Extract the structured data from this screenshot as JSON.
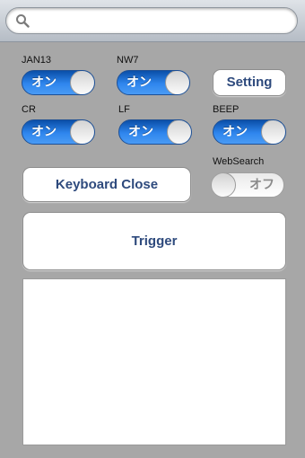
{
  "search": {
    "value": "",
    "placeholder": ""
  },
  "toggles": {
    "jan13": {
      "label": "JAN13",
      "state": "オン"
    },
    "nw7": {
      "label": "NW7",
      "state": "オン"
    },
    "cr": {
      "label": "CR",
      "state": "オン"
    },
    "lf": {
      "label": "LF",
      "state": "オン"
    },
    "beep": {
      "label": "BEEP",
      "state": "オン"
    },
    "websearch": {
      "label": "WebSearch",
      "state": "オフ"
    }
  },
  "buttons": {
    "setting": "Setting",
    "keyboard_close": "Keyboard Close",
    "trigger": "Trigger"
  },
  "colors": {
    "toggle_on": "#2f86ee",
    "button_text": "#2e4a7d",
    "background": "#a7a7a7"
  },
  "icons": {
    "search": "magnifier-icon"
  }
}
